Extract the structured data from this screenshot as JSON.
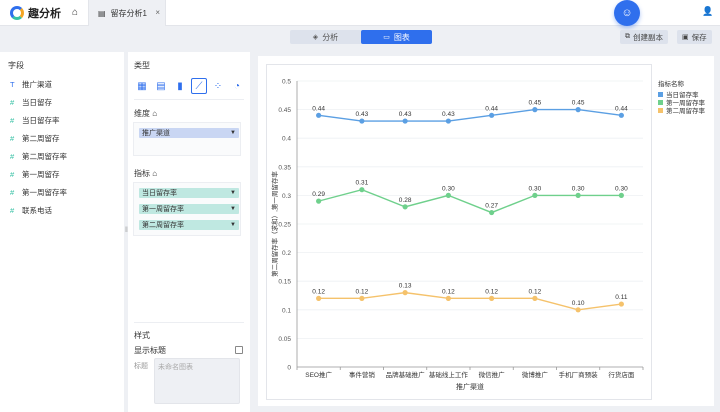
{
  "app": {
    "name": "趣分析"
  },
  "tab": {
    "label": "留存分析1",
    "close": "×"
  },
  "toolbar": {
    "analysis_label": "分析",
    "chart_label": "图表",
    "copy_label": "创建副本",
    "save_label": "保存"
  },
  "fields_panel": {
    "title": "字段",
    "items": [
      {
        "type": "T",
        "label": "推广渠道"
      },
      {
        "type": "#",
        "label": "当日留存"
      },
      {
        "type": "#",
        "label": "当日留存率"
      },
      {
        "type": "#",
        "label": "第二周留存"
      },
      {
        "type": "#",
        "label": "第二周留存率"
      },
      {
        "type": "#",
        "label": "第一周留存"
      },
      {
        "type": "#",
        "label": "第一周留存率"
      },
      {
        "type": "#",
        "label": "联系电话"
      }
    ]
  },
  "config_panel": {
    "type_title": "类型",
    "dimension_title": "维度",
    "dimension_pills": [
      "推广渠道"
    ],
    "measure_title": "指标",
    "measure_pills": [
      "当日留存率",
      "第一周留存率",
      "第二周留存率"
    ],
    "style_title": "样式",
    "show_title_label": "显示标题",
    "title_field_label": "标题",
    "title_placeholder": "未命名图表"
  },
  "chart_data": {
    "type": "line",
    "categories": [
      "SEO推广",
      "事件营销",
      "品牌基础推广",
      "基础线上工作",
      "微信推广",
      "微博推广",
      "手机厂商预装",
      "行货店面"
    ],
    "series": [
      {
        "name": "当日留存率",
        "color": "#5b9fe3",
        "values": [
          0.44,
          0.43,
          0.43,
          0.43,
          0.44,
          0.45,
          0.45,
          0.44
        ],
        "labels": [
          "0.44",
          "0.43",
          "0.43",
          "0.43",
          "0.44",
          "0.45",
          "0.45",
          "0.44"
        ]
      },
      {
        "name": "第一周留存率",
        "color": "#6fd08c",
        "values": [
          0.29,
          0.31,
          0.28,
          0.3,
          0.27,
          0.3,
          0.3,
          0.3
        ],
        "labels": [
          "0.29",
          "0.31",
          "0.28",
          "0.30",
          "0.27",
          "0.30",
          "0.30",
          "0.30"
        ]
      },
      {
        "name": "第二周留存率",
        "color": "#f5c26b",
        "values": [
          0.12,
          0.12,
          0.13,
          0.12,
          0.12,
          0.12,
          0.1,
          0.11
        ],
        "labels": [
          "0.12",
          "0.12",
          "0.13",
          "0.12",
          "0.12",
          "0.12",
          "0.10",
          "0.11"
        ]
      }
    ],
    "yticks": [
      "0",
      "0.05",
      "0.1",
      "0.15",
      "0.2",
      "0.25",
      "0.3",
      "0.35",
      "0.4",
      "0.45",
      "0.5"
    ],
    "ylim": [
      0,
      0.5
    ],
    "xlabel": "推广渠道",
    "ylabel": "第二周留存率（求和）,第一周留存率",
    "legend_title": "指标名称",
    "legend_position": "right"
  }
}
